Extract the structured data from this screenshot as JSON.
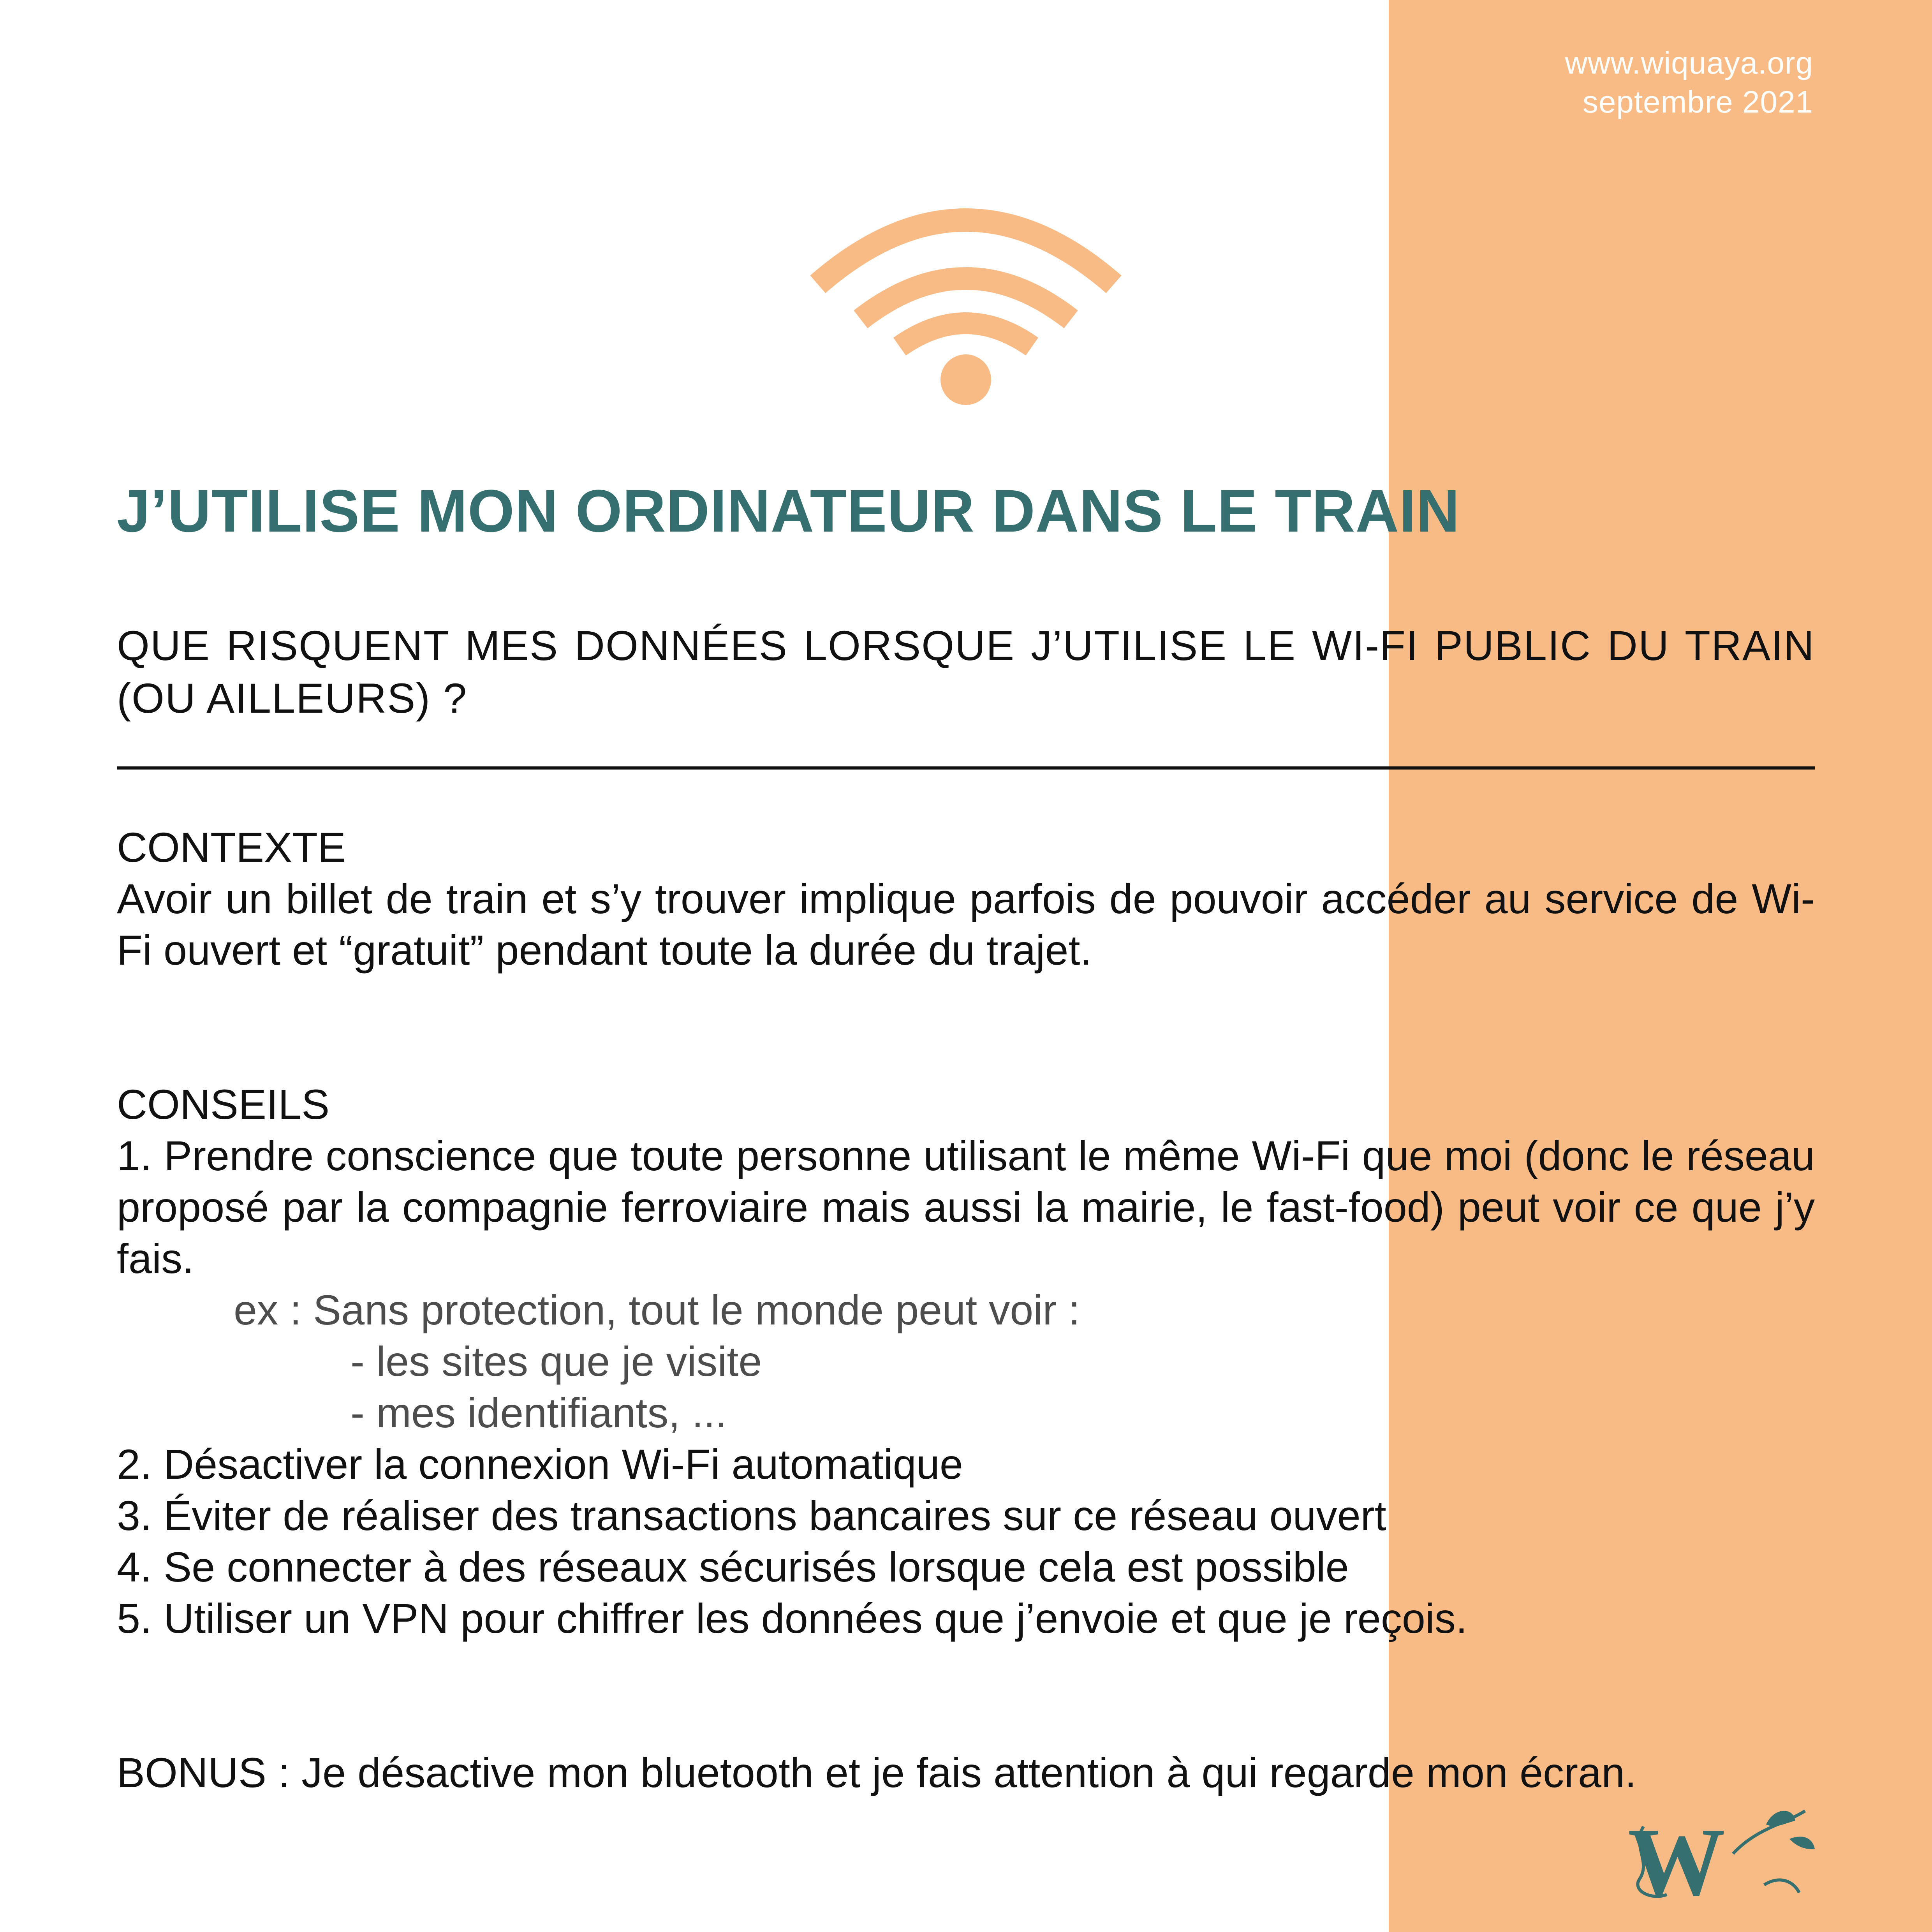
{
  "colors": {
    "accent_band": "#f8bb85",
    "title": "#356f70",
    "text": "#111111",
    "example_text": "#4d4d4d",
    "wifi_icon": "#f8bb85"
  },
  "header": {
    "website": "www.wiquaya.org",
    "date": "septembre 2021"
  },
  "icon": {
    "name": "wifi-icon"
  },
  "title": "J’UTILISE MON ORDINATEUR DANS LE TRAIN",
  "question": "QUE RISQUENT MES DONNÉES LORSQUE J’UTILISE LE WI-FI PUBLIC DU TRAIN (OU AILLEURS) ?",
  "contexte": {
    "heading": "CONTEXTE",
    "text": "Avoir un billet de train et s’y trouver implique parfois de pouvoir accéder au service de Wi-Fi ouvert et “gratuit” pendant toute la durée du trajet."
  },
  "conseils": {
    "heading": "CONSEILS",
    "item1": "1. Prendre conscience que toute personne utilisant le même Wi-Fi que moi (donc le réseau proposé par la compagnie ferroviaire mais aussi la mairie, le fast-food) peut voir ce que j’y fais.",
    "example_intro": "ex : Sans protection, tout le monde peut voir :",
    "example_items": [
      "- les sites que je visite",
      "- mes identifiants, ..."
    ],
    "item2": "2. Désactiver la connexion Wi-Fi automatique",
    "item3": "3. Éviter de réaliser des transactions bancaires sur ce réseau ouvert",
    "item4": "4. Se connecter à des réseaux sécurisés lorsque cela est possible",
    "item5": "5. Utiliser un VPN pour chiffrer les données que j’envoie et que je reçois."
  },
  "bonus": "BONUS : Je désactive mon bluetooth et je fais attention à qui regarde mon écran.",
  "logo": {
    "name": "wiquaya-logo",
    "letter": "W"
  }
}
